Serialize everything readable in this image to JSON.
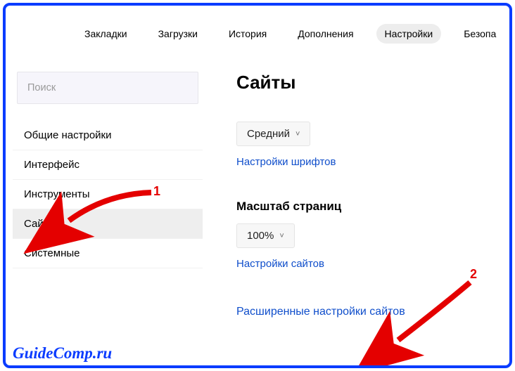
{
  "topbar": {
    "tabs": [
      {
        "label": "Закладки"
      },
      {
        "label": "Загрузки"
      },
      {
        "label": "История"
      },
      {
        "label": "Дополнения"
      },
      {
        "label": "Настройки",
        "active": true
      },
      {
        "label": "Безопа"
      }
    ]
  },
  "sidebar": {
    "search_placeholder": "Поиск",
    "items": [
      {
        "label": "Общие настройки"
      },
      {
        "label": "Интерфейс"
      },
      {
        "label": "Инструменты"
      },
      {
        "label": "Сайты",
        "selected": true
      },
      {
        "label": "Системные"
      }
    ]
  },
  "main": {
    "title": "Сайты",
    "font_size_selector": "Средний",
    "font_settings_link": "Настройки шрифтов",
    "zoom_title": "Масштаб страниц",
    "zoom_selector": "100%",
    "sites_settings_link": "Настройки сайтов",
    "advanced_link": "Расширенные настройки сайтов"
  },
  "annotations": {
    "num1": "1",
    "num2": "2"
  },
  "watermark": "GuideComp.ru"
}
